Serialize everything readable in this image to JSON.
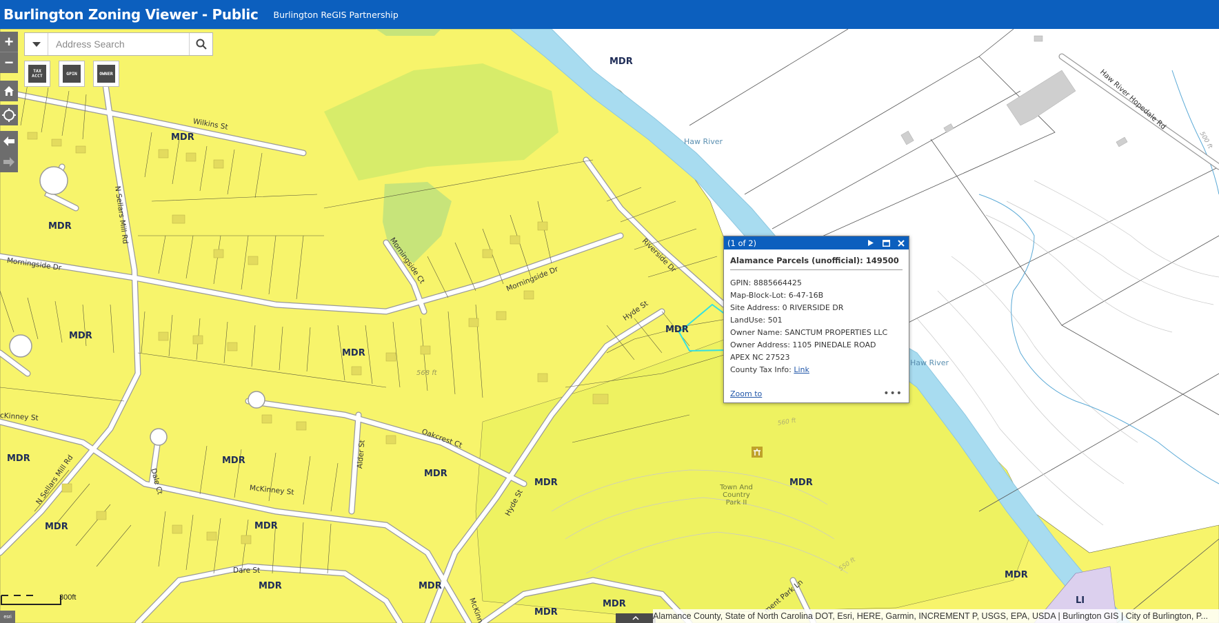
{
  "header": {
    "title": "Burlington Zoning Viewer - Public",
    "subtitle": "Burlington ReGIS Partnership"
  },
  "search": {
    "placeholder": "Address Search"
  },
  "tools": {
    "tax_acct": "TAX ACCT",
    "gpin": "GPIN",
    "owner": "OWNER"
  },
  "zoom": {
    "in": "+",
    "out": "−"
  },
  "zones": [
    "MDR",
    "MDR",
    "MDR",
    "MDR",
    "MDR",
    "MDR",
    "MDR",
    "MDR",
    "MDR",
    "MDR",
    "MDR",
    "MDR",
    "MDR",
    "MDR",
    "MDR",
    "MDR",
    "MDR",
    "MDR",
    "MDR",
    "MDR",
    "MDR",
    "LI"
  ],
  "streets": {
    "wilkins": "Wilkins St",
    "sellars": "N Sellars Mill Rd",
    "sellars2": "N Sellars Mill Rd",
    "morningside": "Morningside Dr",
    "morningside2": "Morningside Dr",
    "morningside_ct": "Morningside Ct",
    "riverside": "Riverside Dr",
    "hyde": "Hyde St",
    "hyde2": "Hyde St",
    "mckinney": "McKinney St",
    "mckinney2": "cKinney St",
    "oakcrest": "Oakcrest Ct",
    "alder": "Alder St",
    "dale": "Dale Ct",
    "dare": "Dare St",
    "hopedale": "Haw River Hopedale Rd",
    "mckinn": "McKinn",
    "park_ln": "ment Park Ln"
  },
  "water": {
    "haw1": "Haw River",
    "haw2": "Haw River"
  },
  "contours": {
    "c568": "568 ft",
    "c560": "560 ft",
    "c550": "550 ft",
    "c500": "500 ft"
  },
  "poi": {
    "park": "Town And Country Park II"
  },
  "popup": {
    "count": "(1 of 2)",
    "title": "Alamance Parcels (unofficial): 149500",
    "rows": [
      "GPIN: 8885664425",
      "Map-Block-Lot: 6-47-16B",
      "Site Address: 0 RIVERSIDE DR",
      "LandUse: 501",
      "Owner Name: SANCTUM PROPERTIES LLC",
      "Owner Address: 1105 PINEDALE ROAD",
      "APEX NC 27523"
    ],
    "tax_info_label": "County Tax Info: ",
    "tax_info_link": "Link",
    "zoom_to": "Zoom to",
    "more": "•••"
  },
  "scale": {
    "label": "300ft"
  },
  "attribution": "Alamance County, State of North Carolina DOT, Esri, HERE, Garmin, INCREMENT P, USGS, EPA, USDA | Burlington GIS | City of Burlington, P...",
  "colors": {
    "header": "#0c5fbe",
    "zone_yellow": "#f7f46b",
    "river": "#a8dcf0",
    "park_green": "#d7ec6a"
  }
}
